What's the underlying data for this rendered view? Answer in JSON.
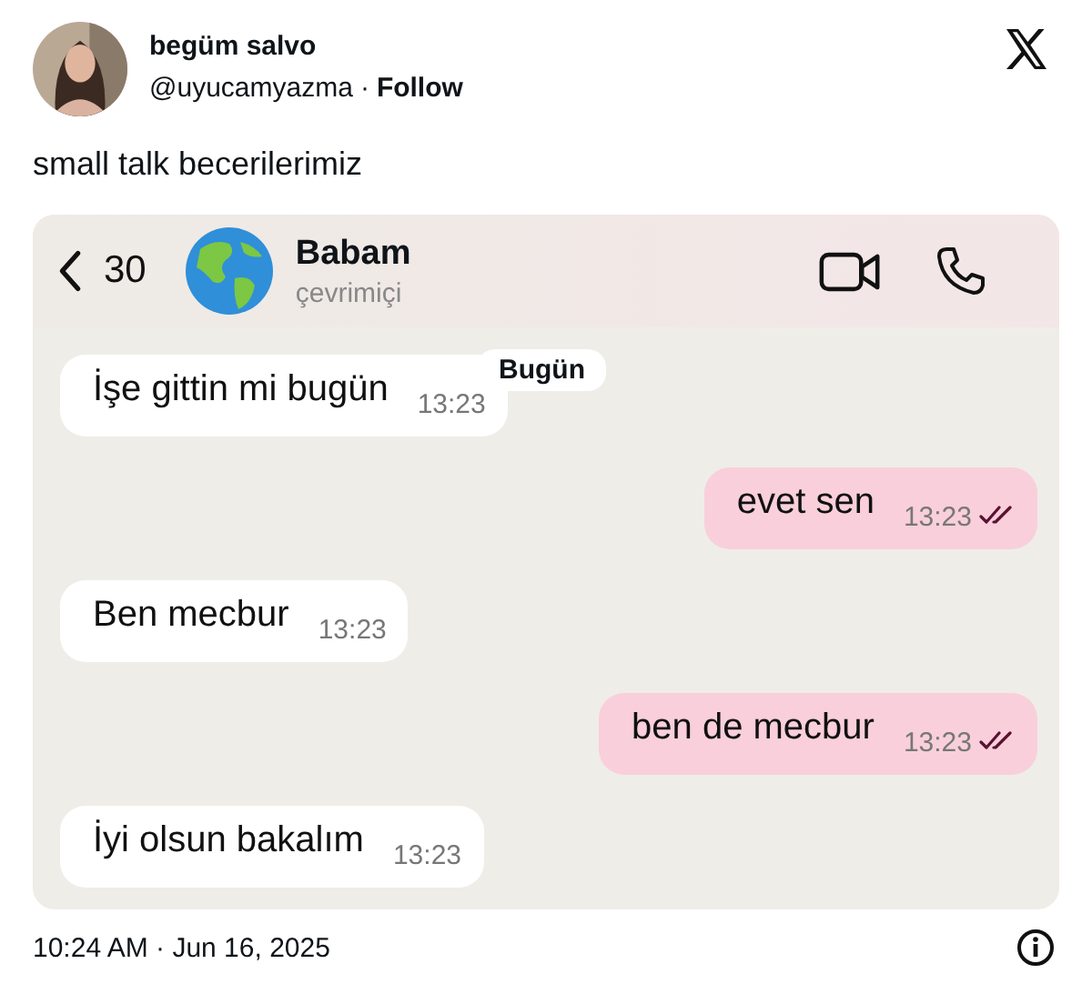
{
  "author": {
    "name": "begüm salvo",
    "handle": "@uyucamyazma",
    "separator": "·",
    "follow": "Follow"
  },
  "tweet_text": "small talk becerilerimiz",
  "chat": {
    "back_count": "30",
    "contact": "Babam",
    "status": "çevrimiçi",
    "date_badge": "Bugün",
    "messages": [
      {
        "kind": "in",
        "text": "İşe gittin mi bugün",
        "time": "13:23"
      },
      {
        "kind": "out",
        "text": "evet sen",
        "time": "13:23",
        "read": true
      },
      {
        "kind": "in",
        "text": "Ben mecbur",
        "time": "13:23"
      },
      {
        "kind": "out",
        "text": "ben de mecbur",
        "time": "13:23",
        "read": true
      },
      {
        "kind": "in",
        "text": "İyi olsun bakalım",
        "time": "13:23"
      }
    ]
  },
  "timestamp": "10:24 AM · Jun 16, 2025"
}
